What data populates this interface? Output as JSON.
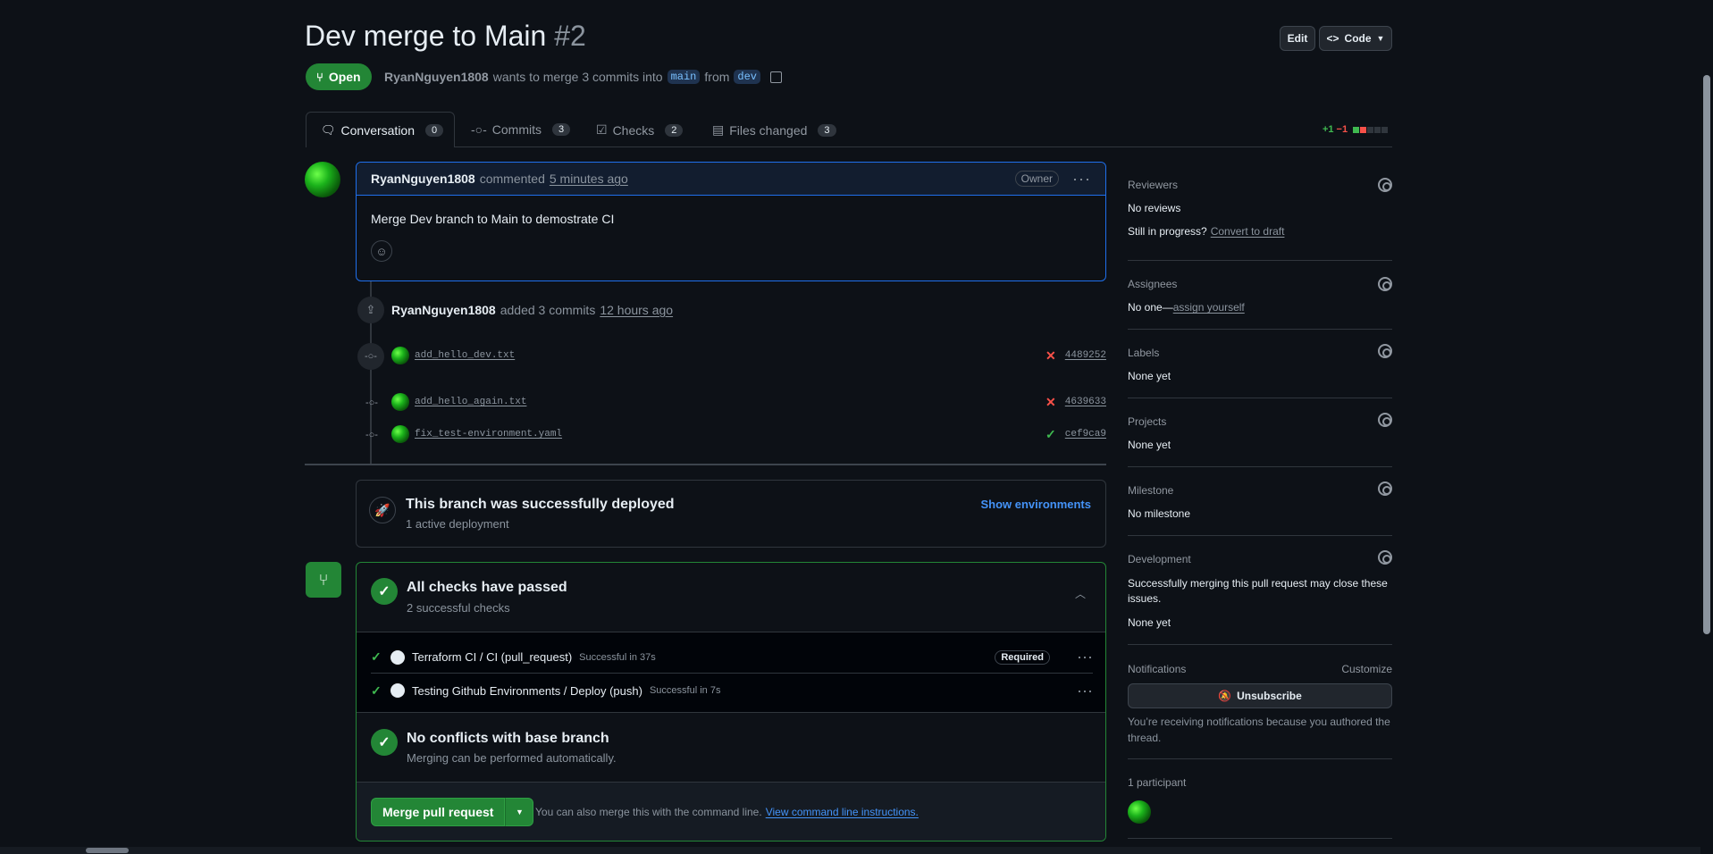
{
  "header": {
    "title": "Dev merge to Main",
    "number": "#2",
    "edit_label": "Edit",
    "code_label": "Code",
    "state_label": "Open",
    "author": "RyanNguyen1808",
    "merge_text": "wants to merge 3 commits into",
    "base_branch": "main",
    "from_text": "from",
    "head_branch": "dev"
  },
  "tabs": [
    {
      "label": "Conversation",
      "count": "0"
    },
    {
      "label": "Commits",
      "count": "3"
    },
    {
      "label": "Checks",
      "count": "2"
    },
    {
      "label": "Files changed",
      "count": "3"
    }
  ],
  "diffstat": {
    "additions": "+1",
    "deletions": "−1"
  },
  "comment": {
    "author": "RyanNguyen1808",
    "action": "commented",
    "time": "5 minutes ago",
    "role_badge": "Owner",
    "body": "Merge Dev branch to Main to demostrate CI"
  },
  "timeline_event": {
    "author": "RyanNguyen1808",
    "action": "added 3 commits",
    "time": "12 hours ago"
  },
  "commits": [
    {
      "message": "add_hello_dev.txt",
      "status": "fail",
      "sha": "4489252"
    },
    {
      "message": "add_hello_again.txt",
      "status": "fail",
      "sha": "4639633"
    },
    {
      "message": "fix_test-environment.yaml",
      "status": "success",
      "sha": "cef9ca9"
    }
  ],
  "deployment": {
    "title": "This branch was successfully deployed",
    "subtitle": "1 active deployment",
    "action_label": "Show environments"
  },
  "checks": {
    "title": "All checks have passed",
    "subtitle": "2 successful checks",
    "items": [
      {
        "name": "Terraform CI / CI (pull_request)",
        "detail": "Successful in 37s",
        "badge": "Required"
      },
      {
        "name": "Testing Github Environments / Deploy (push)",
        "detail": "Successful in 7s",
        "badge": ""
      }
    ]
  },
  "conflicts": {
    "title": "No conflicts with base branch",
    "subtitle": "Merging can be performed automatically."
  },
  "merge": {
    "button_label": "Merge pull request",
    "note": "You can also merge this with the command line.",
    "link_label": "View command line instructions."
  },
  "sidebar": {
    "reviewers": {
      "title": "Reviewers",
      "value": "No reviews",
      "prompt": "Still in progress?",
      "link": "Convert to draft"
    },
    "assignees": {
      "title": "Assignees",
      "value": "No one—",
      "link": "assign yourself"
    },
    "labels": {
      "title": "Labels",
      "value": "None yet"
    },
    "projects": {
      "title": "Projects",
      "value": "None yet"
    },
    "milestone": {
      "title": "Milestone",
      "value": "No milestone"
    },
    "development": {
      "title": "Development",
      "text": "Successfully merging this pull request may close these issues.",
      "value": "None yet"
    },
    "notifications": {
      "title": "Notifications",
      "customize": "Customize",
      "button": "Unsubscribe",
      "note": "You’re receiving notifications because you authored the thread."
    },
    "participants": {
      "title": "1 participant"
    }
  },
  "colors": {
    "success": "#238636",
    "danger": "#f85149",
    "accent": "#4493f8",
    "bg": "#0d1117"
  }
}
